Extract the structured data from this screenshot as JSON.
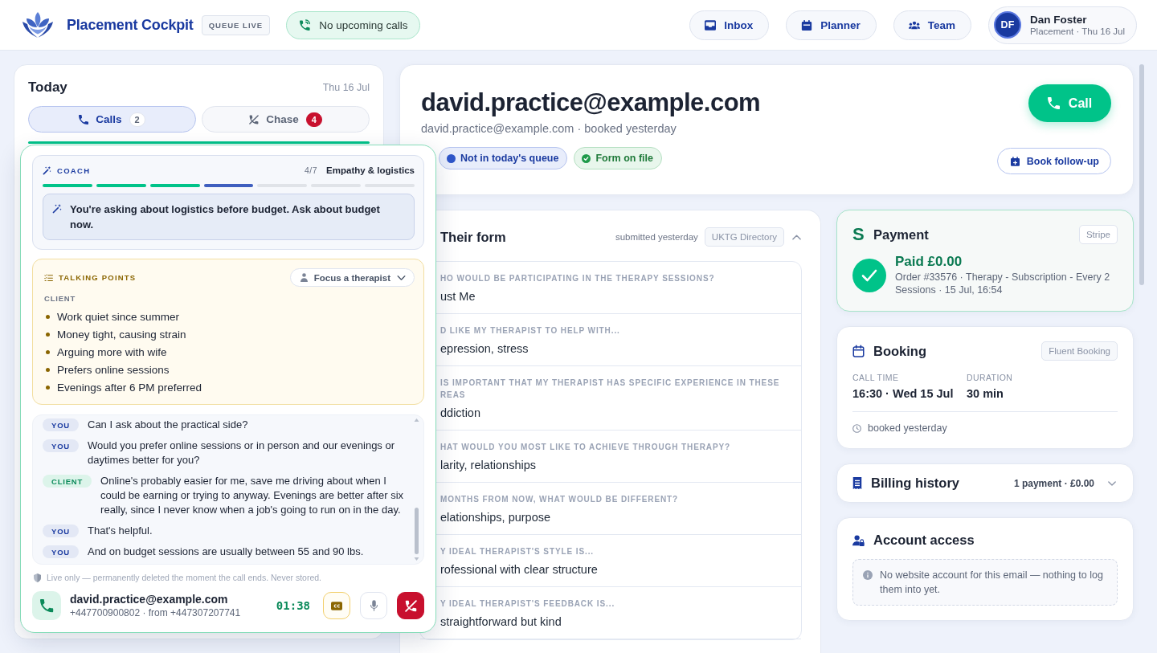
{
  "header": {
    "app_name": "Placement Cockpit",
    "status_badge": "QUEUE LIVE",
    "upcoming": "No upcoming calls",
    "nav": [
      {
        "label": "Inbox"
      },
      {
        "label": "Planner"
      },
      {
        "label": "Team"
      }
    ],
    "user": {
      "initials": "DF",
      "name": "Dan Foster",
      "subtitle": "Placement · Thu 16 Jul"
    }
  },
  "today": {
    "title": "Today",
    "date": "Thu 16 Jul",
    "tabs": [
      {
        "label": "Calls",
        "count": "2",
        "selected": true,
        "urgent": false
      },
      {
        "label": "Chase",
        "count": "4",
        "selected": false,
        "urgent": true
      }
    ]
  },
  "contact": {
    "title": "david.practice@example.com",
    "subtitle": "david.practice@example.com · booked yesterday",
    "chips": [
      {
        "label": "Not in today's queue",
        "kind": "info"
      },
      {
        "label": "Form on file",
        "kind": "success"
      }
    ],
    "call_button": "Call",
    "follow_up_button": "Book follow-up"
  },
  "form": {
    "title": "Their form",
    "submitted": "submitted yesterday",
    "source": "UKTG Directory",
    "expanded": true,
    "fields": [
      {
        "label": "HO WOULD BE PARTICIPATING IN THE THERAPY SESSIONS?",
        "value": "ust Me"
      },
      {
        "label": "D LIKE MY THERAPIST TO HELP WITH...",
        "value": "epression, stress"
      },
      {
        "label": "IS IMPORTANT THAT MY THERAPIST HAS SPECIFIC EXPERIENCE IN THESE REAS",
        "value": "ddiction"
      },
      {
        "label": "HAT WOULD YOU MOST LIKE TO ACHIEVE THROUGH THERAPY?",
        "value": "larity, relationships"
      },
      {
        "label": "MONTHS FROM NOW, WHAT WOULD BE DIFFERENT?",
        "value": "elationships, purpose"
      },
      {
        "label": "Y IDEAL THERAPIST'S STYLE IS...",
        "value": "rofessional with clear structure"
      },
      {
        "label": "Y IDEAL THERAPIST'S FEEDBACK IS...",
        "value": "straightforward but kind"
      }
    ]
  },
  "payment": {
    "logo": "S",
    "title": "Payment",
    "provider": "Stripe",
    "status": "Paid £0.00",
    "details": "Order #33576 · Therapy - Subscription - Every 2 Sessions · 15 Jul, 16:54"
  },
  "booking": {
    "title": "Booking",
    "provider": "Fluent Booking",
    "facts": [
      {
        "label": "CALL TIME",
        "value": "16:30 · Wed 15 Jul"
      },
      {
        "label": "DURATION",
        "value": "30 min"
      }
    ],
    "note": "booked yesterday"
  },
  "billing": {
    "title": "Billing history",
    "summary": "1 payment · £0.00",
    "expanded": false
  },
  "account": {
    "title": "Account access",
    "notice": "No website account for this email — nothing to log them into yet."
  },
  "call_panel": {
    "coach": {
      "label": "COACH",
      "step": "4/7",
      "stage": "Empathy & logistics",
      "steps": [
        {
          "done": true,
          "current": false
        },
        {
          "done": true,
          "current": false
        },
        {
          "done": true,
          "current": false
        },
        {
          "done": false,
          "current": true
        },
        {
          "done": false,
          "current": false
        },
        {
          "done": false,
          "current": false
        },
        {
          "done": false,
          "current": false
        }
      ],
      "tip": "You're asking about logistics before budget. Ask about budget now."
    },
    "talking_points": {
      "label": "TALKING POINTS",
      "focus_button": "Focus a therapist",
      "group": "CLIENT",
      "points": [
        "Work quiet since summer",
        "Money tight, causing strain",
        "Arguing more with wife",
        "Prefers online sessions",
        "Evenings after 6 PM preferred"
      ]
    },
    "transcript": [
      {
        "speaker": "YOU",
        "kind": "agent",
        "text": "Can I ask about the practical side?"
      },
      {
        "speaker": "YOU",
        "kind": "agent",
        "text": "Would you prefer online sessions or in person and our evenings or daytimes better for you?"
      },
      {
        "speaker": "CLIENT",
        "kind": "client",
        "text": "Online's probably easier for me, save me driving about when I could be earning or trying to anyway. Evenings are better after six really, since I never know when a job's going to run on in the day."
      },
      {
        "speaker": "YOU",
        "kind": "agent",
        "text": "That's helpful."
      },
      {
        "speaker": "YOU",
        "kind": "agent",
        "text": "And on budget sessions are usually between 55 and 90 lbs."
      }
    ],
    "privacy_note": "Live only — permanently deleted the moment the call ends. Never stored.",
    "caller": {
      "name": "david.practice@example.com",
      "numbers": "+447700900802 · from +447307207741"
    },
    "timer": "01:38",
    "controls": [
      {
        "kind": "captions",
        "on": true
      },
      {
        "kind": "mute",
        "on": false
      },
      {
        "kind": "hangup"
      }
    ]
  }
}
